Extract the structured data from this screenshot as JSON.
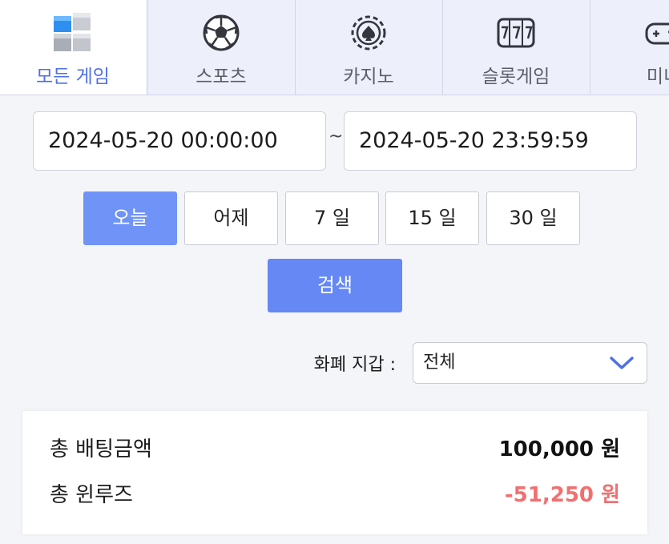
{
  "tabs": [
    {
      "label": "모든 게임",
      "icon": "cubes-icon",
      "active": true
    },
    {
      "label": "스포츠",
      "icon": "soccer-ball-icon",
      "active": false
    },
    {
      "label": "카지노",
      "icon": "casino-chip-icon",
      "active": false
    },
    {
      "label": "슬롯게임",
      "icon": "slot-machine-icon",
      "active": false
    },
    {
      "label": "미니",
      "icon": "gamepad-icon",
      "active": false
    }
  ],
  "date_range": {
    "start": "2024-05-20 00:00:00",
    "separator": "~",
    "end": "2024-05-20 23:59:59"
  },
  "quick_ranges": [
    {
      "label": "오늘",
      "active": true
    },
    {
      "label": "어제",
      "active": false
    },
    {
      "label": "7 일",
      "active": false
    },
    {
      "label": "15 일",
      "active": false
    },
    {
      "label": "30 일",
      "active": false
    }
  ],
  "search_button": "검색",
  "currency_filter": {
    "label": "화폐 지갑 :",
    "selected": "전체",
    "icon": "chevron-down-icon"
  },
  "summary": {
    "total_bet_label": "총 배팅금액",
    "total_bet_value": "100,000 원",
    "total_winloss_label": "총 윈루즈",
    "total_winloss_value": "-51,250 원"
  },
  "colors": {
    "accent": "#6688f4",
    "active_tab_text": "#4f6fe8",
    "negative": "#f07070",
    "tab_bg": "#edf0fb"
  }
}
